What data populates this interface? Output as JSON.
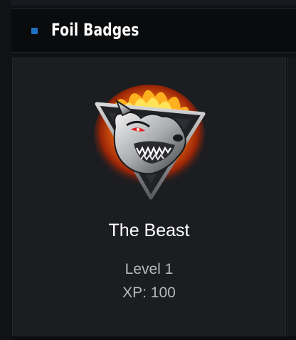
{
  "section": {
    "title": "Foil Badges",
    "accent_color": "#1f6fc0"
  },
  "badge": {
    "icon": "wolf-flame-icon",
    "name": "The Beast",
    "level": "Level 1",
    "xp": "XP: 100"
  }
}
